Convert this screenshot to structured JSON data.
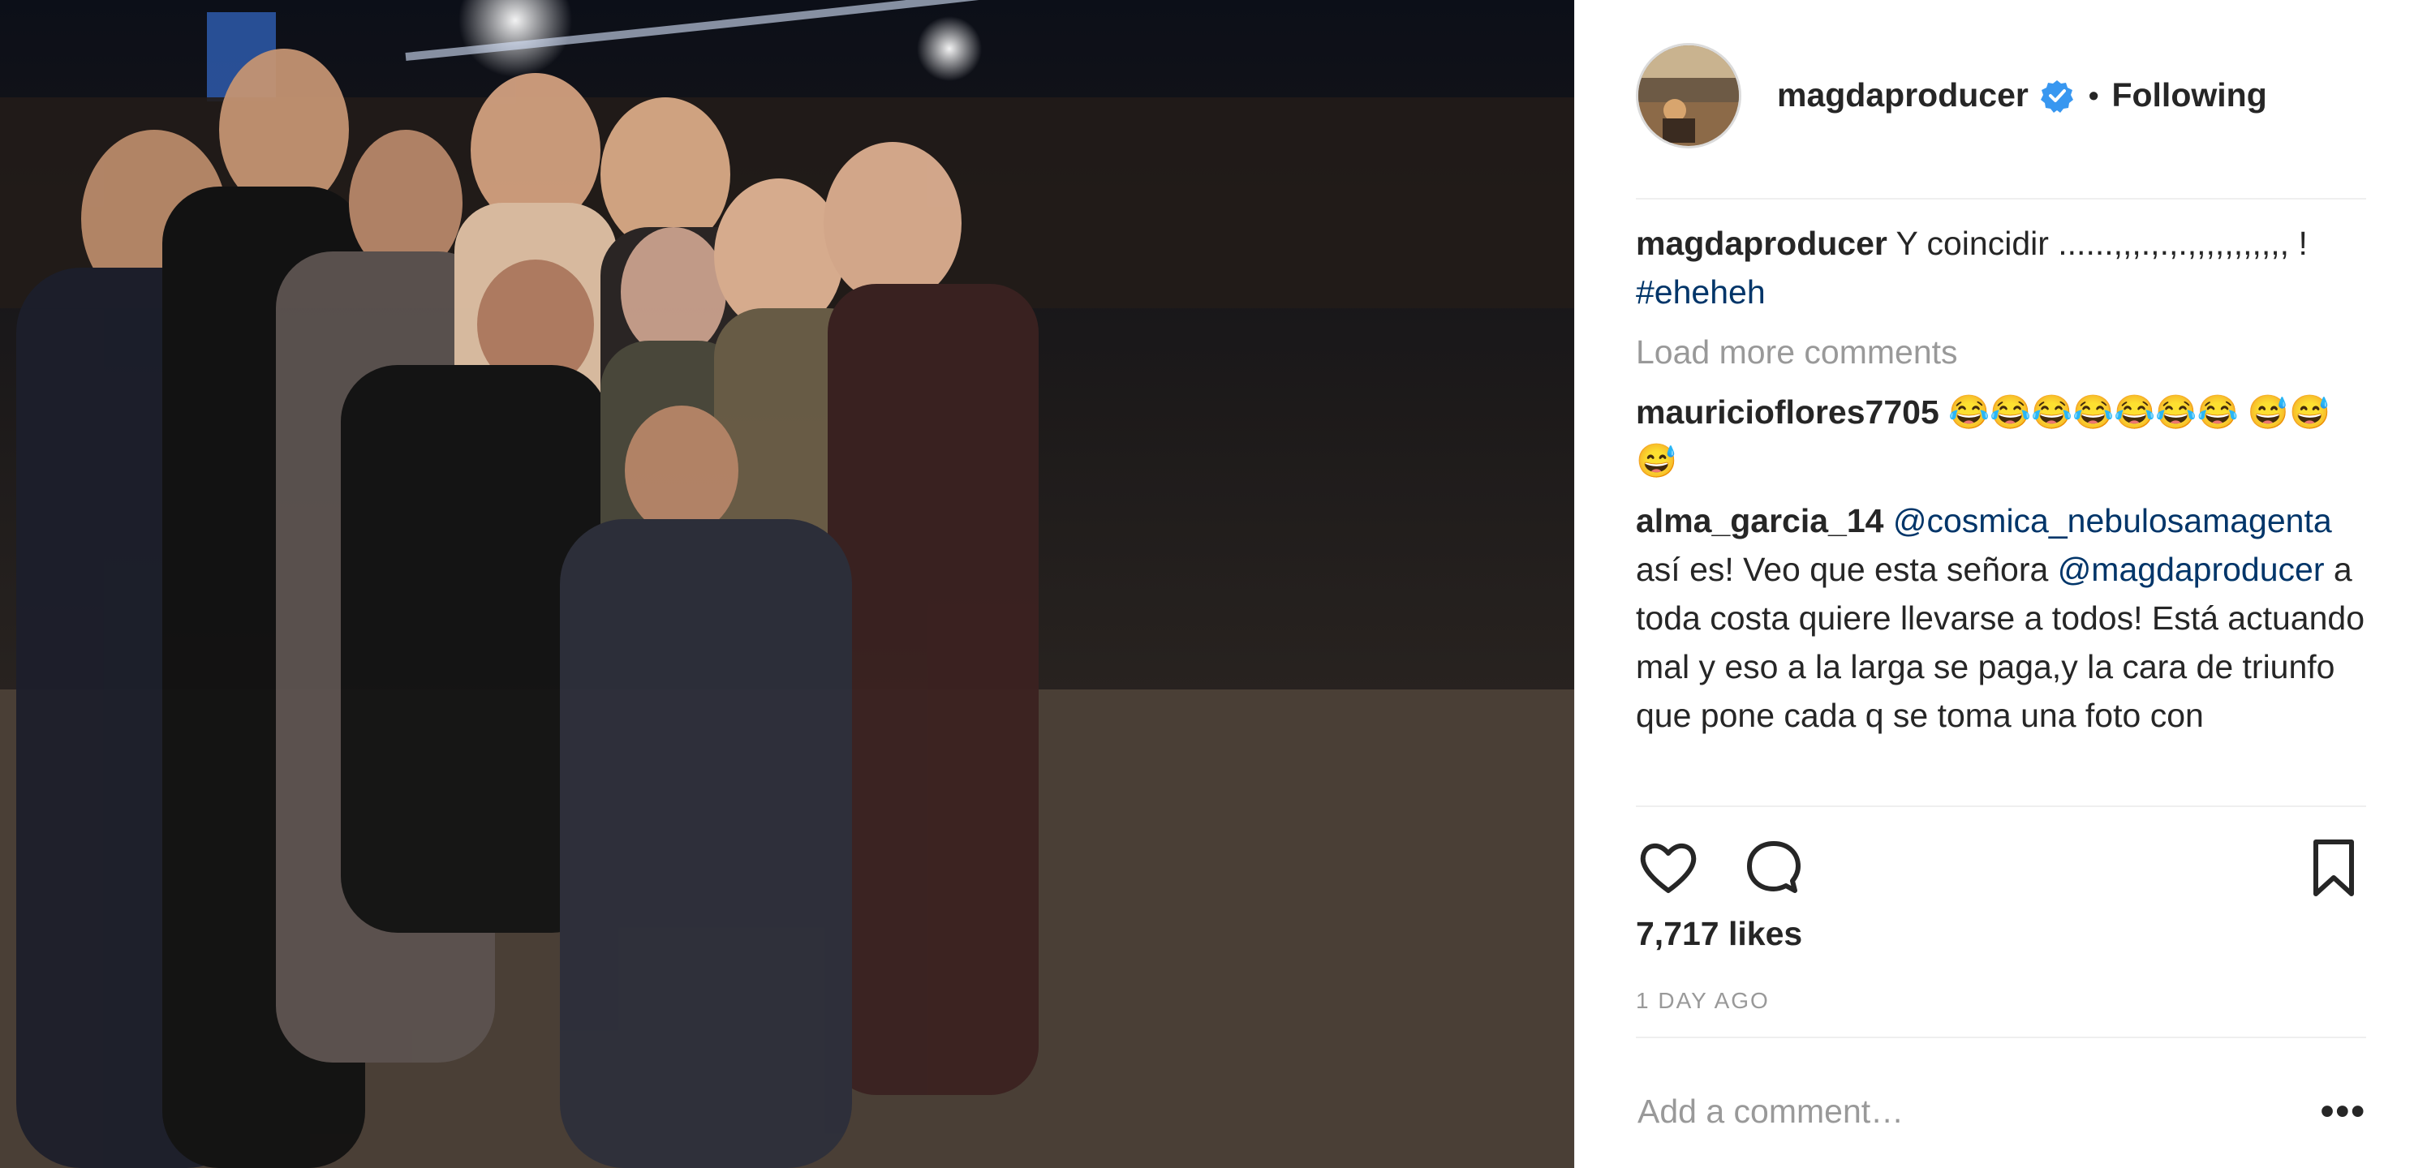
{
  "colors": {
    "text": "#262626",
    "muted": "#999999",
    "link": "#003569",
    "verified_blue": "#3897f0",
    "divider": "#efefef"
  },
  "header": {
    "username": "magdaproducer",
    "separator": "•",
    "follow_state": "Following",
    "verified_icon": "verified-badge-icon",
    "avatar_icon": "profile-avatar"
  },
  "caption": {
    "username": "magdaproducer",
    "text": "Y coincidir ......,,,.,.,.,,,,,,,,,,, ! ",
    "hashtag": "#eheheh"
  },
  "load_more": "Load more comments",
  "comments": [
    {
      "username": "mauricioflores7705",
      "text": "😂😂😂😂😂😂😂 😅😅😅"
    },
    {
      "username": "alma_garcia_14",
      "mention": "@cosmica_nebulosamagenta",
      "text_a": " así es! Veo que esta señora ",
      "mention2": "@magdaproducer",
      "text_b": " a toda costa quiere llevarse a todos! Está actuando mal y eso a la larga se paga,y la cara de triunfo que pone cada q se toma una foto con"
    }
  ],
  "actions": {
    "like_icon": "heart-icon",
    "comment_icon": "comment-icon",
    "save_icon": "bookmark-icon"
  },
  "likes": "7,717 likes",
  "time_ago": "1 DAY AGO",
  "add_comment": {
    "placeholder": "Add a comment…",
    "more_label": "•••",
    "more_icon": "more-options-icon"
  },
  "photo": {
    "icon": "post-photo"
  }
}
